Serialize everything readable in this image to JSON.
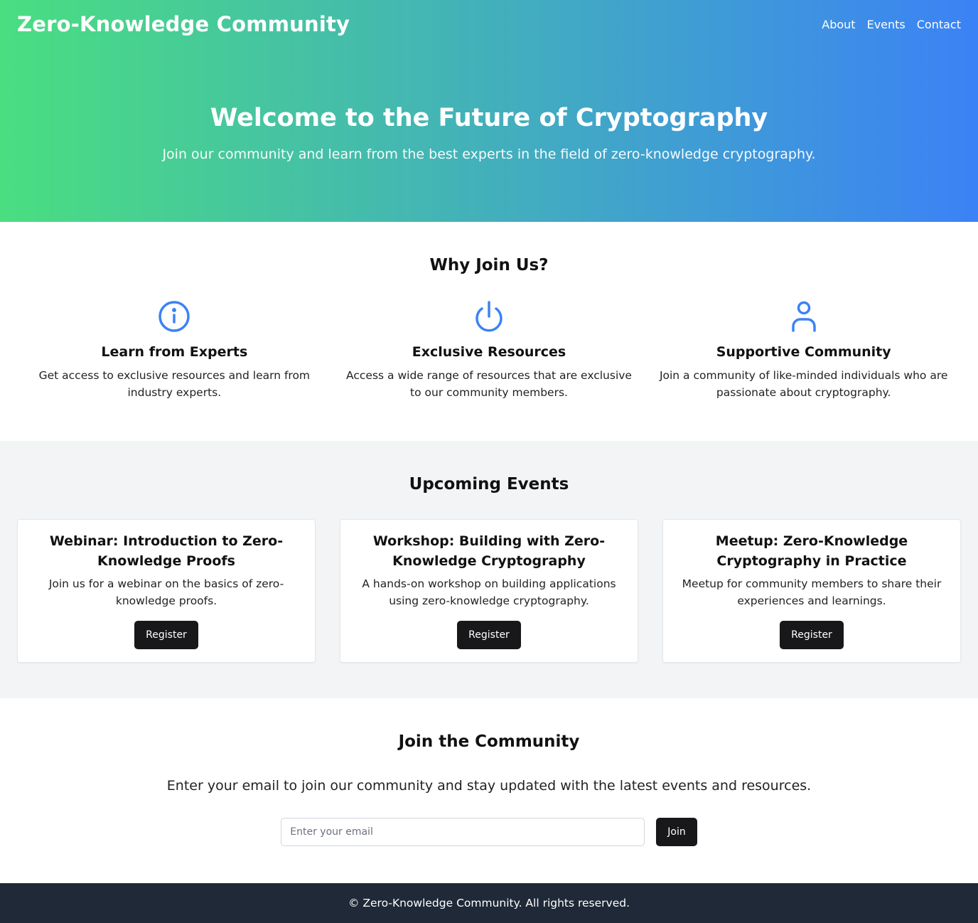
{
  "header": {
    "brand": "Zero-Knowledge Community",
    "nav": [
      "About",
      "Events",
      "Contact"
    ]
  },
  "hero": {
    "title": "Welcome to the Future of Cryptography",
    "subtitle": "Join our community and learn from the best experts in the field of zero-knowledge cryptography."
  },
  "features": {
    "title": "Why Join Us?",
    "items": [
      {
        "icon": "info-icon",
        "title": "Learn from Experts",
        "desc": "Get access to exclusive resources and learn from industry experts."
      },
      {
        "icon": "power-icon",
        "title": "Exclusive Resources",
        "desc": "Access a wide range of resources that are exclusive to our community members."
      },
      {
        "icon": "user-icon",
        "title": "Supportive Community",
        "desc": "Join a community of like-minded individuals who are passionate about cryptography."
      }
    ]
  },
  "events": {
    "title": "Upcoming Events",
    "items": [
      {
        "title": "Webinar: Introduction to Zero-Knowledge Proofs",
        "desc": "Join us for a webinar on the basics of zero-knowledge proofs.",
        "button": "Register"
      },
      {
        "title": "Workshop: Building with Zero-Knowledge Cryptography",
        "desc": "A hands-on workshop on building applications using zero-knowledge cryptography.",
        "button": "Register"
      },
      {
        "title": "Meetup: Zero-Knowledge Cryptography in Practice",
        "desc": "Meetup for community members to share their experiences and learnings.",
        "button": "Register"
      }
    ]
  },
  "join": {
    "title": "Join the Community",
    "text": "Enter your email to join our community and stay updated with the latest events and resources.",
    "placeholder": "Enter your email",
    "button": "Join"
  },
  "footer": {
    "text": "© Zero-Knowledge Community. All rights reserved."
  },
  "colors": {
    "gradient_start": "#4ade80",
    "gradient_end": "#3b82f6",
    "icon": "#3b82f6",
    "button": "#18181b",
    "events_bg": "#f3f4f6",
    "footer_bg": "#1f2937"
  }
}
